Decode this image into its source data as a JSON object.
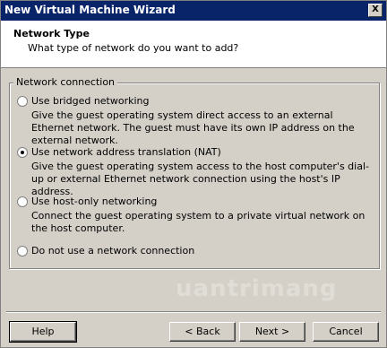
{
  "window": {
    "title": "New Virtual Machine Wizard",
    "close_glyph": "X"
  },
  "header": {
    "title": "Network Type",
    "subtitle": "What type of network do you want to add?"
  },
  "group": {
    "label": "Network connection",
    "options": [
      {
        "label": "Use bridged networking",
        "description": "Give the guest operating system direct access to an external Ethernet network. The guest must have its own IP address on the external network.",
        "checked": false
      },
      {
        "label": "Use network address translation (NAT)",
        "description": "Give the guest operating system access to the host computer's dial-up or external Ethernet network connection using the host's IP address.",
        "checked": true
      },
      {
        "label": "Use host-only networking",
        "description": "Connect the guest operating system to a private virtual network on the host computer.",
        "checked": false
      },
      {
        "label": "Do not use a network connection",
        "description": "",
        "checked": false
      }
    ]
  },
  "buttons": {
    "help": "Help",
    "back": "< Back",
    "next": "Next >",
    "cancel": "Cancel"
  },
  "watermark": "uantrimang"
}
